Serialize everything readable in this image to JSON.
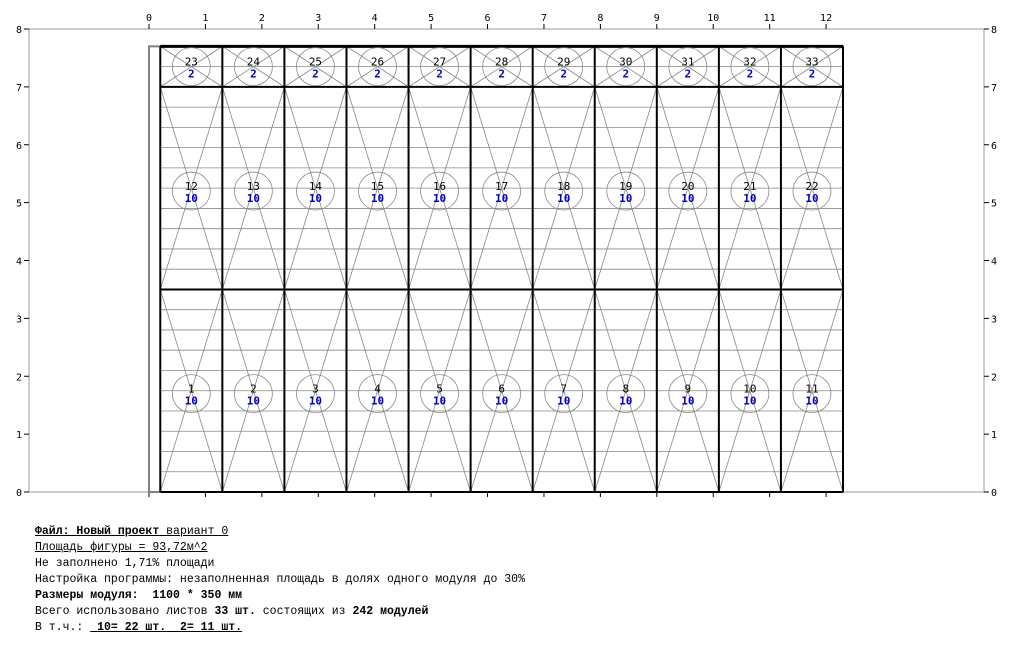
{
  "axes": {
    "x_ticks": [
      "0",
      "1",
      "2",
      "3",
      "4",
      "5",
      "6",
      "7",
      "8",
      "9",
      "10",
      "11",
      "12"
    ],
    "y_ticks": [
      "0",
      "1",
      "2",
      "3",
      "4",
      "5",
      "6",
      "7",
      "8"
    ],
    "x_max": 12.3,
    "y_max": 8
  },
  "figure": {
    "x_start": 0,
    "x_end": 12.3,
    "y_end": 7.7
  },
  "module_grid": {
    "columns": 11,
    "module_width_m": 1.1,
    "module_height_m": 0.35,
    "start_x": 0.2,
    "row_breaks": [
      0,
      3.5,
      7.0,
      7.7
    ]
  },
  "sheets": [
    {
      "num": "1",
      "qty": "10",
      "col": 0,
      "row": 0
    },
    {
      "num": "2",
      "qty": "10",
      "col": 1,
      "row": 0
    },
    {
      "num": "3",
      "qty": "10",
      "col": 2,
      "row": 0
    },
    {
      "num": "4",
      "qty": "10",
      "col": 3,
      "row": 0
    },
    {
      "num": "5",
      "qty": "10",
      "col": 4,
      "row": 0
    },
    {
      "num": "6",
      "qty": "10",
      "col": 5,
      "row": 0
    },
    {
      "num": "7",
      "qty": "10",
      "col": 6,
      "row": 0
    },
    {
      "num": "8",
      "qty": "10",
      "col": 7,
      "row": 0
    },
    {
      "num": "9",
      "qty": "10",
      "col": 8,
      "row": 0
    },
    {
      "num": "10",
      "qty": "10",
      "col": 9,
      "row": 0
    },
    {
      "num": "11",
      "qty": "10",
      "col": 10,
      "row": 0
    },
    {
      "num": "12",
      "qty": "10",
      "col": 0,
      "row": 1
    },
    {
      "num": "13",
      "qty": "10",
      "col": 1,
      "row": 1
    },
    {
      "num": "14",
      "qty": "10",
      "col": 2,
      "row": 1
    },
    {
      "num": "15",
      "qty": "10",
      "col": 3,
      "row": 1
    },
    {
      "num": "16",
      "qty": "10",
      "col": 4,
      "row": 1
    },
    {
      "num": "17",
      "qty": "10",
      "col": 5,
      "row": 1
    },
    {
      "num": "18",
      "qty": "10",
      "col": 6,
      "row": 1
    },
    {
      "num": "19",
      "qty": "10",
      "col": 7,
      "row": 1
    },
    {
      "num": "20",
      "qty": "10",
      "col": 8,
      "row": 1
    },
    {
      "num": "21",
      "qty": "10",
      "col": 9,
      "row": 1
    },
    {
      "num": "22",
      "qty": "10",
      "col": 10,
      "row": 1
    },
    {
      "num": "23",
      "qty": "2",
      "col": 0,
      "row": 2
    },
    {
      "num": "24",
      "qty": "2",
      "col": 1,
      "row": 2
    },
    {
      "num": "25",
      "qty": "2",
      "col": 2,
      "row": 2
    },
    {
      "num": "26",
      "qty": "2",
      "col": 3,
      "row": 2
    },
    {
      "num": "27",
      "qty": "2",
      "col": 4,
      "row": 2
    },
    {
      "num": "28",
      "qty": "2",
      "col": 5,
      "row": 2
    },
    {
      "num": "29",
      "qty": "2",
      "col": 6,
      "row": 2
    },
    {
      "num": "30",
      "qty": "2",
      "col": 7,
      "row": 2
    },
    {
      "num": "31",
      "qty": "2",
      "col": 8,
      "row": 2
    },
    {
      "num": "32",
      "qty": "2",
      "col": 9,
      "row": 2
    },
    {
      "num": "33",
      "qty": "2",
      "col": 10,
      "row": 2
    }
  ],
  "colors": {
    "qty_text": "#0000cc",
    "thin_line": "#888888",
    "bold_line": "#000000"
  },
  "info": {
    "file_label": "Файл:",
    "file_name": "Новый проект",
    "variant": "вариант 0",
    "area": "Площадь фигуры = 93,72м^2",
    "unfilled": "Не заполнено 1,71% площади",
    "settings": "Настройка программы: незаполненная площадь в долях одного модуля до 30%",
    "module_size_label": "Размеры модуля:",
    "module_size_value": "1100 * 350 мм",
    "total_prefix": "Всего использовано листов",
    "total_sheets": "33 шт.",
    "total_mid": "состоящих из",
    "total_modules": "242 модулей",
    "incl_label": "В т.ч.:",
    "incl_10": "10= 22 шт.",
    "incl_2": "2= 11 шт."
  }
}
